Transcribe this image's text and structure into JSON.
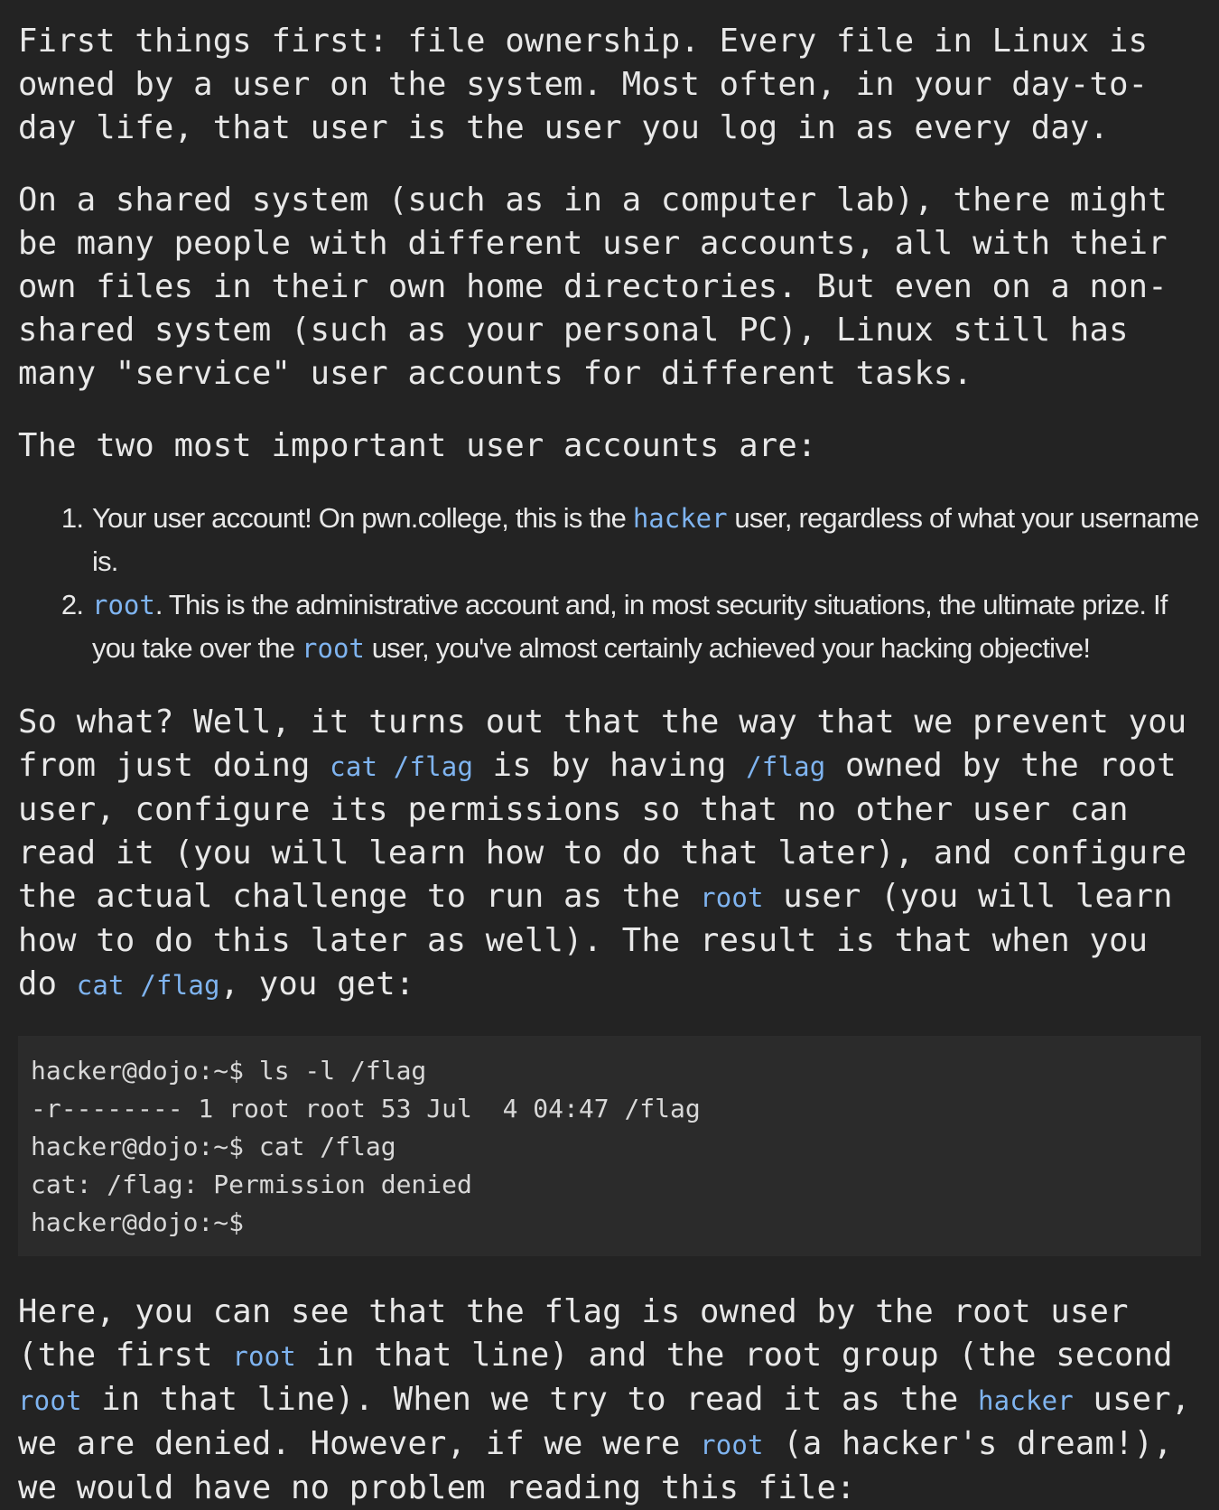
{
  "p1": "First things first: file ownership. Every file in Linux is owned by a user on the system. Most often, in your day-to-day life, that user is the user you log in as every day.",
  "p2": "On a shared system (such as in a computer lab), there might be many people with different user accounts, all with their own files in their own home directories. But even on a non-shared system (such as your personal PC), Linux still has many \"service\" user accounts for different tasks.",
  "p3": "The two most important user accounts are:",
  "list": {
    "item1": {
      "pre": "Your user account! On pwn.college, this is the ",
      "code": "hacker",
      "post": " user, regardless of what your username is."
    },
    "item2": {
      "code1": "root",
      "mid": ". This is the administrative account and, in most security situations, the ultimate prize. If you take over the ",
      "code2": "root",
      "post": " user, you've almost certainly achieved your hacking objective!"
    }
  },
  "p4": {
    "t1": "So what? Well, it turns out that the way that we prevent you from just doing ",
    "c1": "cat /flag",
    "t2": " is by having ",
    "c2": "/flag",
    "t3": " owned by the root user, configure its permissions so that no other user can read it (you will learn how to do that later), and configure the actual challenge to run as the ",
    "c3": "root",
    "t4": " user (you will learn how to do this later as well). The result is that when you do ",
    "c4": "cat /flag",
    "t5": ", you get:"
  },
  "terminal": {
    "lines": [
      "hacker@dojo:~$ ls -l /flag",
      "-r-------- 1 root root 53 Jul  4 04:47 /flag",
      "hacker@dojo:~$ cat /flag",
      "cat: /flag: Permission denied",
      "hacker@dojo:~$"
    ]
  },
  "p5": {
    "t1": "Here, you can see that the flag is owned by the root user (the first ",
    "c1": "root",
    "t2": " in that line) and the root group (the second ",
    "c2": "root",
    "t3": " in that line). When we try to read it as the ",
    "c3": "hacker",
    "t4": " user, we are denied. However, if we were ",
    "c4": "root",
    "t5": " (a hacker's dream!), we would have no problem reading this file:"
  }
}
